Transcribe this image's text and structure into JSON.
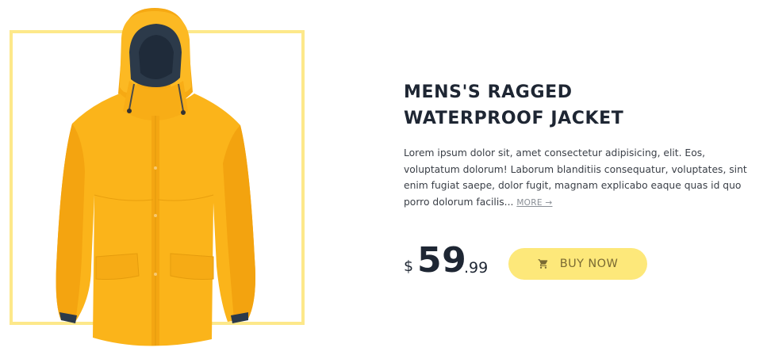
{
  "product": {
    "title_line1": "MENS'S RAGGED",
    "title_line2": "WATERPROOF JACKET",
    "description": "Lorem ipsum dolor sit, amet consectetur adipisicing, elit. Eos, voluptatum dolorum! Laborum blanditiis consequatur, voluptates, sint enim fugiat saepe, dolor fugit, magnam explicabo eaque quas id quo porro dolorum facilis... ",
    "more_link": "MORE →",
    "image_icon": "jacket-image",
    "colors": {
      "jacket": "#fbb41a",
      "frame": "#fde88a",
      "button": "#fde87a"
    }
  },
  "price": {
    "currency": "$",
    "whole": "59",
    "cents": ".99"
  },
  "actions": {
    "buy_label": "BUY NOW",
    "buy_icon": "cart-icon"
  }
}
